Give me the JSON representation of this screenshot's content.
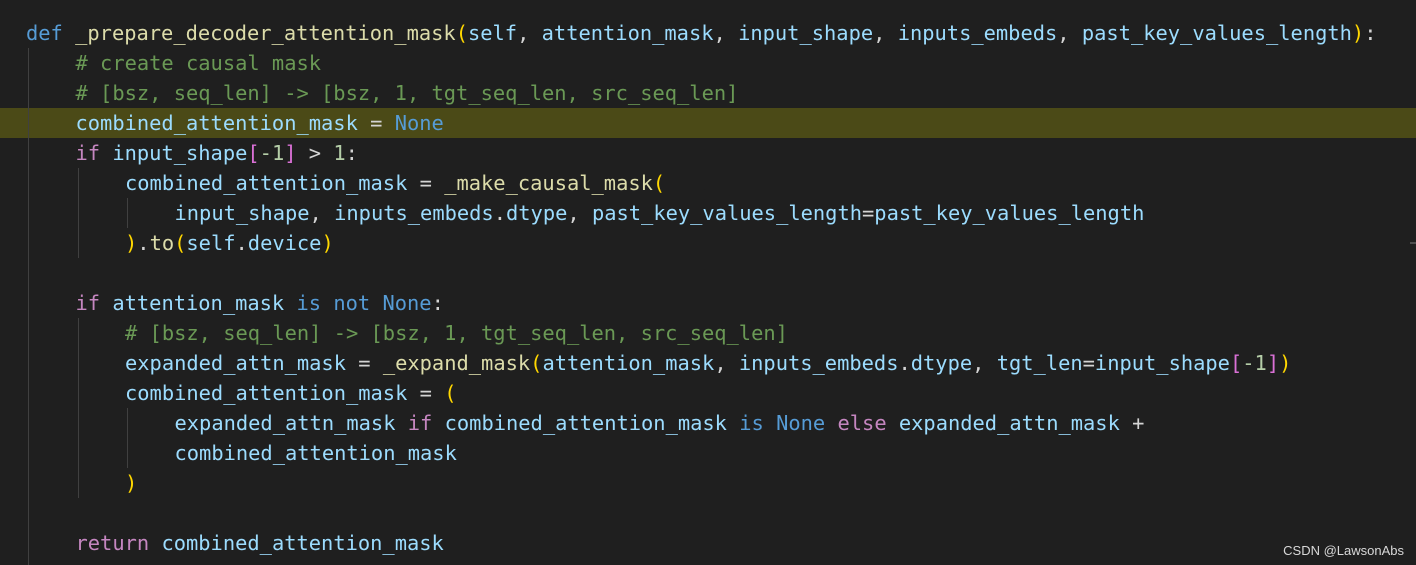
{
  "editor": {
    "highlighted_line": 4,
    "lines": [
      {
        "indent": 0,
        "tokens": [
          {
            "t": "def",
            "c": "keyword"
          },
          {
            "t": " ",
            "c": "plain"
          },
          {
            "t": "_prepare_decoder_attention_mask",
            "c": "function"
          },
          {
            "t": "(",
            "c": "paren1"
          },
          {
            "t": "self",
            "c": "param"
          },
          {
            "t": ", ",
            "c": "plain"
          },
          {
            "t": "attention_mask",
            "c": "param"
          },
          {
            "t": ", ",
            "c": "plain"
          },
          {
            "t": "input_shape",
            "c": "param"
          },
          {
            "t": ", ",
            "c": "plain"
          },
          {
            "t": "inputs_embeds",
            "c": "param"
          },
          {
            "t": ", ",
            "c": "plain"
          },
          {
            "t": "past_key_values_length",
            "c": "param"
          },
          {
            "t": ")",
            "c": "paren1"
          },
          {
            "t": ":",
            "c": "plain"
          }
        ]
      },
      {
        "indent": 1,
        "tokens": [
          {
            "t": "# create causal mask",
            "c": "comment"
          }
        ]
      },
      {
        "indent": 1,
        "tokens": [
          {
            "t": "# [bsz, seq_len] -> [bsz, 1, tgt_seq_len, src_seq_len]",
            "c": "comment"
          }
        ]
      },
      {
        "indent": 1,
        "tokens": [
          {
            "t": "combined_attention_mask",
            "c": "param"
          },
          {
            "t": " = ",
            "c": "plain"
          },
          {
            "t": "None",
            "c": "const"
          }
        ]
      },
      {
        "indent": 1,
        "tokens": [
          {
            "t": "if",
            "c": "flow"
          },
          {
            "t": " ",
            "c": "plain"
          },
          {
            "t": "input_shape",
            "c": "param"
          },
          {
            "t": "[",
            "c": "paren2"
          },
          {
            "t": "-1",
            "c": "number"
          },
          {
            "t": "]",
            "c": "paren2"
          },
          {
            "t": " > ",
            "c": "plain"
          },
          {
            "t": "1",
            "c": "number"
          },
          {
            "t": ":",
            "c": "plain"
          }
        ]
      },
      {
        "indent": 2,
        "tokens": [
          {
            "t": "combined_attention_mask",
            "c": "param"
          },
          {
            "t": " = ",
            "c": "plain"
          },
          {
            "t": "_make_causal_mask",
            "c": "function"
          },
          {
            "t": "(",
            "c": "paren1"
          }
        ]
      },
      {
        "indent": 3,
        "tokens": [
          {
            "t": "input_shape",
            "c": "param"
          },
          {
            "t": ", ",
            "c": "plain"
          },
          {
            "t": "inputs_embeds",
            "c": "param"
          },
          {
            "t": ".",
            "c": "plain"
          },
          {
            "t": "dtype",
            "c": "param"
          },
          {
            "t": ", ",
            "c": "plain"
          },
          {
            "t": "past_key_values_length",
            "c": "param"
          },
          {
            "t": "=",
            "c": "plain"
          },
          {
            "t": "past_key_values_length",
            "c": "param"
          }
        ]
      },
      {
        "indent": 2,
        "tokens": [
          {
            "t": ")",
            "c": "paren1"
          },
          {
            "t": ".",
            "c": "plain"
          },
          {
            "t": "to",
            "c": "function"
          },
          {
            "t": "(",
            "c": "paren1"
          },
          {
            "t": "self",
            "c": "param"
          },
          {
            "t": ".",
            "c": "plain"
          },
          {
            "t": "device",
            "c": "param"
          },
          {
            "t": ")",
            "c": "paren1"
          }
        ]
      },
      {
        "indent": 0,
        "tokens": []
      },
      {
        "indent": 1,
        "tokens": [
          {
            "t": "if",
            "c": "flow"
          },
          {
            "t": " ",
            "c": "plain"
          },
          {
            "t": "attention_mask",
            "c": "param"
          },
          {
            "t": " ",
            "c": "plain"
          },
          {
            "t": "is",
            "c": "keyword"
          },
          {
            "t": " ",
            "c": "plain"
          },
          {
            "t": "not",
            "c": "keyword"
          },
          {
            "t": " ",
            "c": "plain"
          },
          {
            "t": "None",
            "c": "const"
          },
          {
            "t": ":",
            "c": "plain"
          }
        ]
      },
      {
        "indent": 2,
        "tokens": [
          {
            "t": "# [bsz, seq_len] -> [bsz, 1, tgt_seq_len, src_seq_len]",
            "c": "comment"
          }
        ]
      },
      {
        "indent": 2,
        "tokens": [
          {
            "t": "expanded_attn_mask",
            "c": "param"
          },
          {
            "t": " = ",
            "c": "plain"
          },
          {
            "t": "_expand_mask",
            "c": "function"
          },
          {
            "t": "(",
            "c": "paren1"
          },
          {
            "t": "attention_mask",
            "c": "param"
          },
          {
            "t": ", ",
            "c": "plain"
          },
          {
            "t": "inputs_embeds",
            "c": "param"
          },
          {
            "t": ".",
            "c": "plain"
          },
          {
            "t": "dtype",
            "c": "param"
          },
          {
            "t": ", ",
            "c": "plain"
          },
          {
            "t": "tgt_len",
            "c": "param"
          },
          {
            "t": "=",
            "c": "plain"
          },
          {
            "t": "input_shape",
            "c": "param"
          },
          {
            "t": "[",
            "c": "paren2"
          },
          {
            "t": "-1",
            "c": "number"
          },
          {
            "t": "]",
            "c": "paren2"
          },
          {
            "t": ")",
            "c": "paren1"
          }
        ]
      },
      {
        "indent": 2,
        "tokens": [
          {
            "t": "combined_attention_mask",
            "c": "param"
          },
          {
            "t": " = ",
            "c": "plain"
          },
          {
            "t": "(",
            "c": "paren1"
          }
        ]
      },
      {
        "indent": 3,
        "tokens": [
          {
            "t": "expanded_attn_mask",
            "c": "param"
          },
          {
            "t": " ",
            "c": "plain"
          },
          {
            "t": "if",
            "c": "flow"
          },
          {
            "t": " ",
            "c": "plain"
          },
          {
            "t": "combined_attention_mask",
            "c": "param"
          },
          {
            "t": " ",
            "c": "plain"
          },
          {
            "t": "is",
            "c": "keyword"
          },
          {
            "t": " ",
            "c": "plain"
          },
          {
            "t": "None",
            "c": "const"
          },
          {
            "t": " ",
            "c": "plain"
          },
          {
            "t": "else",
            "c": "flow"
          },
          {
            "t": " ",
            "c": "plain"
          },
          {
            "t": "expanded_attn_mask",
            "c": "param"
          },
          {
            "t": " +",
            "c": "plain"
          }
        ]
      },
      {
        "indent": 3,
        "tokens": [
          {
            "t": "combined_attention_mask",
            "c": "param"
          }
        ]
      },
      {
        "indent": 2,
        "tokens": [
          {
            "t": ")",
            "c": "paren1"
          }
        ]
      },
      {
        "indent": 0,
        "tokens": []
      },
      {
        "indent": 1,
        "tokens": [
          {
            "t": "return",
            "c": "flow"
          },
          {
            "t": " ",
            "c": "plain"
          },
          {
            "t": "combined_attention_mask",
            "c": "param"
          }
        ]
      }
    ]
  },
  "watermark": "CSDN @LawsonAbs"
}
